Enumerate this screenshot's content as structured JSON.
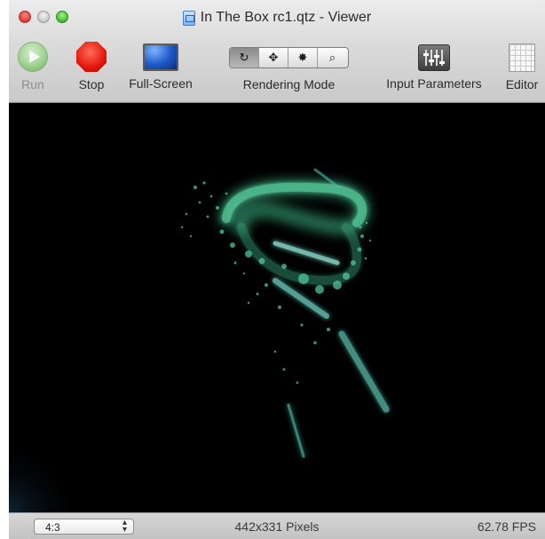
{
  "window": {
    "title": "In The Box rc1.qtz - Viewer"
  },
  "toolbar": {
    "run_label": "Run",
    "stop_label": "Stop",
    "fullscreen_label": "Full-Screen",
    "rendering_mode_label": "Rendering Mode",
    "rendering_modes": [
      "↻",
      "✥",
      "✸",
      "⌕"
    ],
    "input_parameters_label": "Input Parameters",
    "editor_label": "Editor"
  },
  "status": {
    "aspect_ratio": "4:3",
    "dimensions": "442x331 Pixels",
    "fps": "62.78 FPS"
  },
  "colors": {
    "particle": "#3fbf8f",
    "canvas_bg": "#000000"
  }
}
